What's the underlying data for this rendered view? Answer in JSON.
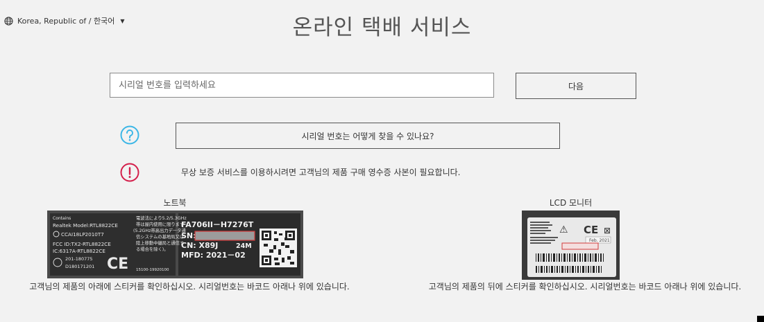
{
  "locale": {
    "label": "Korea, Republic of / 한국어"
  },
  "header": {
    "title": "온라인 택배 서비스"
  },
  "serial": {
    "placeholder": "시리얼 번호를 입력하세요",
    "next_label": "다음"
  },
  "help": {
    "find_label": "시리얼 번호는 어떻게 찾을 수 있나요?"
  },
  "notice": {
    "text": "무상 보증 서비스를 이용하시려면 고객님의 제품 구매 영수증 사본이 필요합니다."
  },
  "laptop": {
    "caption": "노트북",
    "description": "고객님의 제품의 아래에 스티커를 확인하십시오. 시리얼번호는 바코드 아래나 위에 있습니다.",
    "sticker_left": {
      "contains": "Contains",
      "model": "Realtek Model:RTL8822CE",
      "ccai": "CCAI18LP2010T7",
      "fcc": "FCC ID:TX2-RTL8822CE",
      "ic": "IC:6317A-RTL8822CE",
      "jp1": "電波法により5.2/5.3GHz",
      "jp2": "帯は屋内使用に限ります",
      "jp3": "(5.2GHz帯高出力データ通",
      "jp4": "信システムの基地局又は",
      "jp5": "陸上移動中継局と通信す",
      "jp6": "る場合を除く)。",
      "cert1": "201-180775",
      "cert2": "D180171201",
      "cert3": "15100-19920100"
    },
    "sticker_right": {
      "model": "FA706II－H7276T",
      "sn": "SN:",
      "cn": "CN:  X89J",
      "size": "24M",
      "mfd": "MFD:  2021－02"
    }
  },
  "monitor": {
    "caption": "LCD 모니터",
    "description": "고객님의 제품의 뒤에 스티커를 확인하십시오. 시리얼번호는 바코드 아래나 위에 있습니다.",
    "sticker": {
      "date": "Feb. 2021"
    }
  },
  "colors": {
    "help_icon": "#3bb6e6",
    "warn_icon": "#d41e4a",
    "background": "#f2f2f2"
  }
}
